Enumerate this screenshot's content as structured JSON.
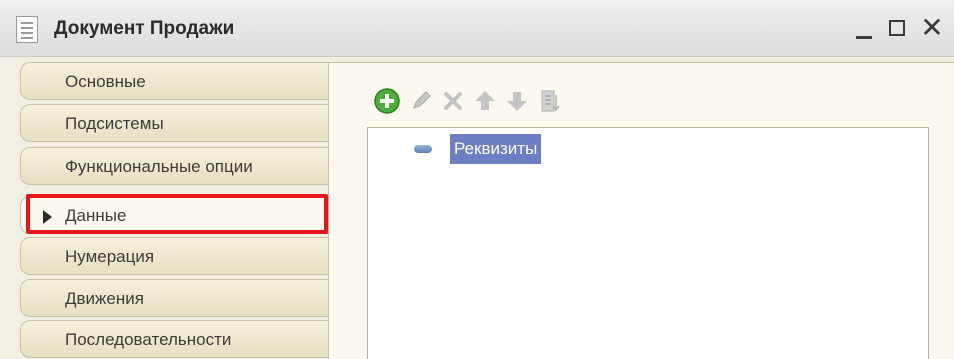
{
  "window": {
    "title": "Документ Продажи",
    "close_glyph": "✕"
  },
  "tabs": [
    {
      "label": "Основные",
      "active": false
    },
    {
      "label": "Подсистемы",
      "active": false
    },
    {
      "label": "Функциональные опции",
      "active": false
    },
    {
      "label": "Данные",
      "active": true
    },
    {
      "label": "Нумерация",
      "active": false
    },
    {
      "label": "Движения",
      "active": false
    },
    {
      "label": "Последовательности",
      "active": false
    }
  ],
  "toolbar": {
    "icons": [
      "add-icon",
      "edit-icon",
      "delete-icon",
      "move-up-icon",
      "move-down-icon",
      "sort-icon"
    ]
  },
  "tree": {
    "root_label": "Реквизиты"
  },
  "colors": {
    "highlight": "#e8141a",
    "selection": "#6c7ec4",
    "tab_bg": "#ede8cf"
  }
}
